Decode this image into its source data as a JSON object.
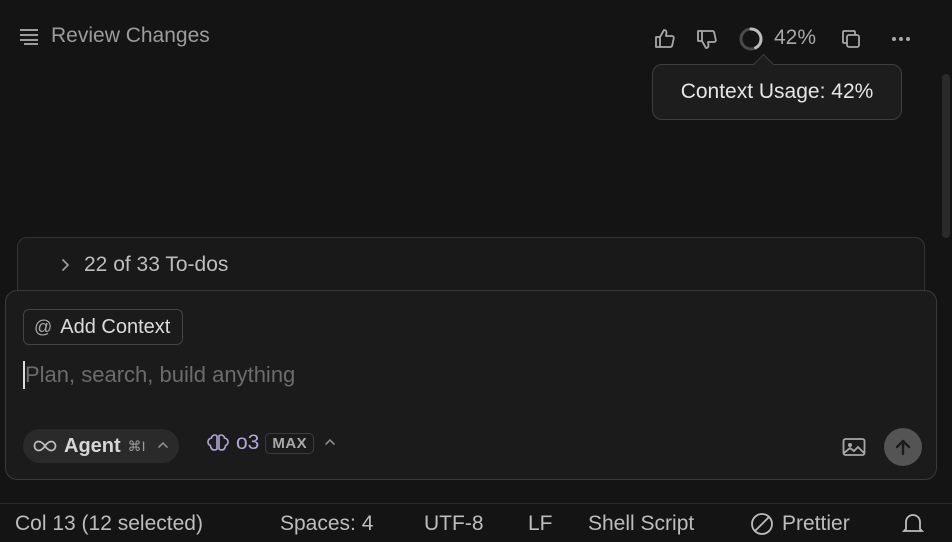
{
  "header": {
    "title": "Review Changes",
    "context_percent": "42%",
    "tooltip": "Context Usage: 42%",
    "context_usage_fraction": 0.42
  },
  "todos": {
    "label": "22 of 33 To-dos"
  },
  "composer": {
    "add_context_label": "Add Context",
    "at_symbol": "@",
    "placeholder": "Plan, search, build anything",
    "value": "",
    "agent_label": "Agent",
    "agent_shortcut": "⌘I",
    "model_label": "o3",
    "max_badge": "MAX"
  },
  "statusbar": {
    "cursor": "Col 13 (12 selected)",
    "spaces": "Spaces: 4",
    "encoding": "UTF-8",
    "eol": "LF",
    "language": "Shell Script",
    "formatter": "Prettier"
  },
  "icons": {
    "review": "list-icon",
    "like": "thumbs-up-icon",
    "dislike": "thumbs-down-icon",
    "progress": "progress-ring-icon",
    "copy": "copy-icon",
    "more": "more-icon",
    "chevron": "chevron-right-icon",
    "infinity": "infinity-icon",
    "brain": "brain-icon",
    "image": "image-icon",
    "send": "arrow-up-icon",
    "prettier": "no-entry-icon",
    "bell": "bell-icon"
  }
}
